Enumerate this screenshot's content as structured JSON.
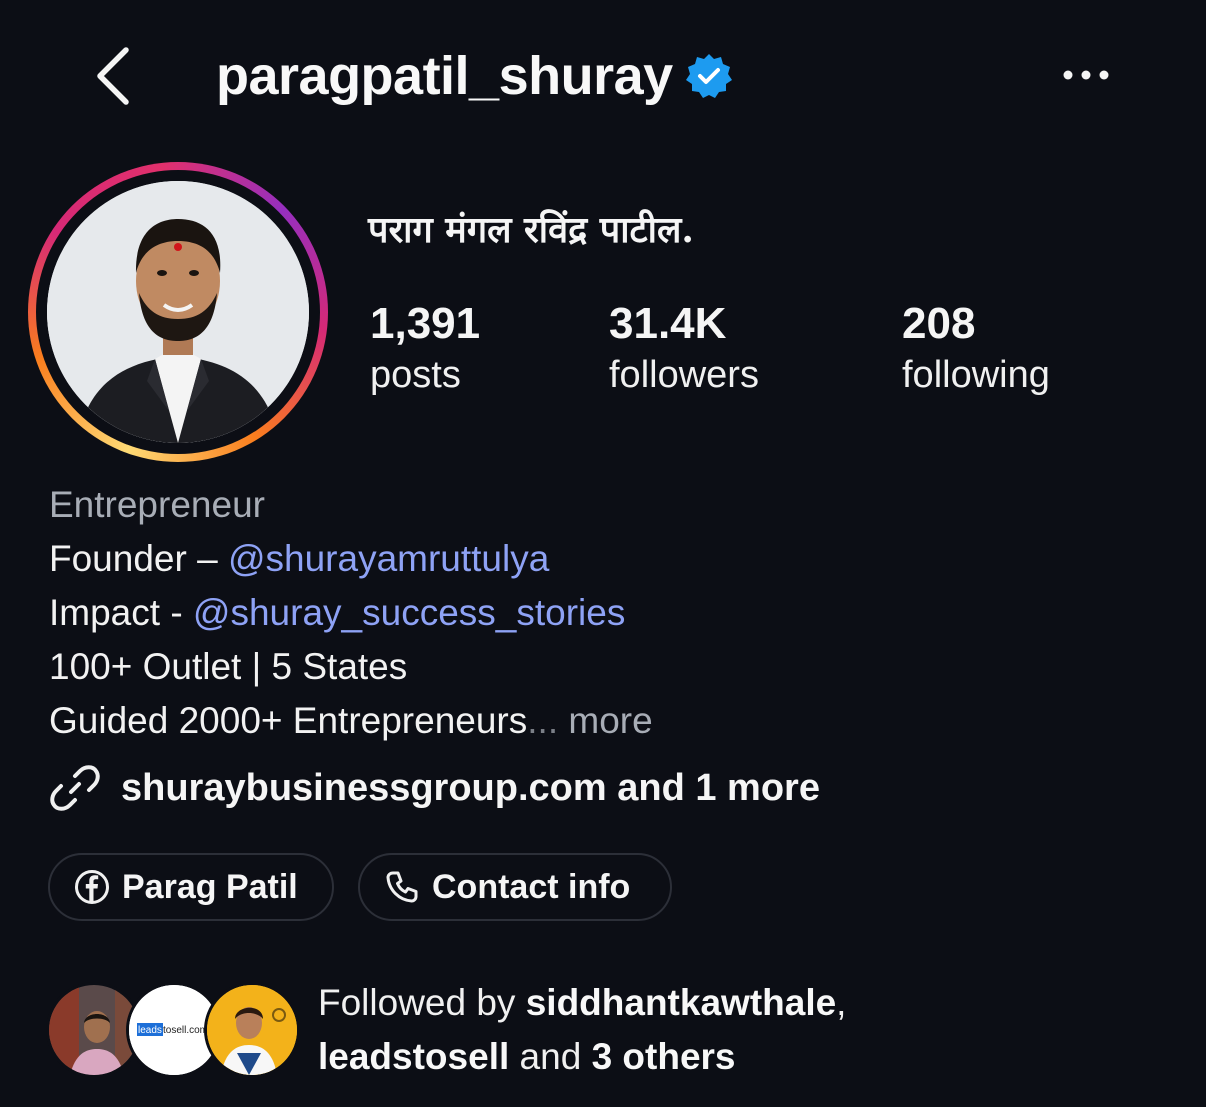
{
  "header": {
    "back_icon": "chevron-left-icon",
    "username": "paragpatil_shuray",
    "verified_icon": "verified-badge-icon",
    "more_icon": "more-horizontal-icon"
  },
  "profile": {
    "full_name": "पराग मंगल रविंद्र पाटील.",
    "stats": [
      {
        "value": "1,391",
        "label": "posts"
      },
      {
        "value": "31.4K",
        "label": "followers"
      },
      {
        "value": "208",
        "label": "following"
      }
    ]
  },
  "bio": {
    "category": "Entrepreneur",
    "line1_prefix": "Founder – ",
    "line1_mention": "@shurayamruttulya",
    "line2_prefix": "Impact - ",
    "line2_mention": "@shuray_success_stories",
    "line3": "100+ Outlet | 5 States",
    "line4": "Guided 2000+ Entrepreneurs",
    "ellipsis": "...",
    "more": "more"
  },
  "link": {
    "icon": "link-icon",
    "text": "shuraybusinessgroup.com and 1 more"
  },
  "pills": [
    {
      "icon": "facebook-icon",
      "label": "Parag Patil"
    },
    {
      "icon": "phone-icon",
      "label": "Contact info"
    }
  ],
  "followed_by": {
    "prefix": "Followed by ",
    "user1": "siddhantkawthale",
    "comma": ",",
    "user2": "leadstosell",
    "middle": " and ",
    "others": "3 others",
    "avatar2_text": "leadstosell.com"
  },
  "colors": {
    "background": "#0c0e15",
    "mention": "#8ea2f5",
    "verified": "#1d9bf0",
    "muted": "#a8adb6"
  }
}
